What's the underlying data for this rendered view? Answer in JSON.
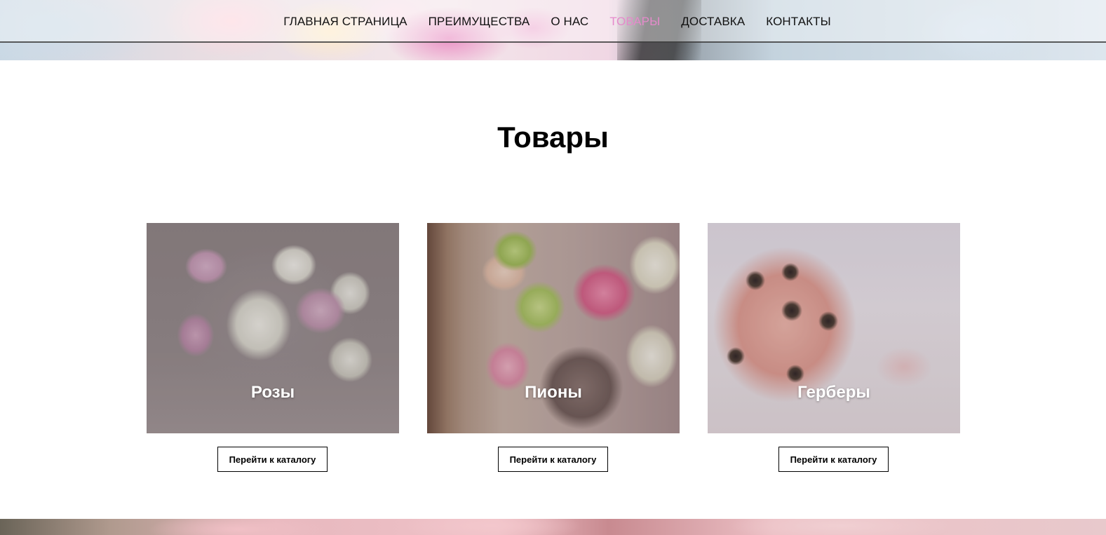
{
  "nav": {
    "items": [
      {
        "label": "ГЛАВНАЯ СТРАНИЦА"
      },
      {
        "label": "ПРЕИМУЩЕСТВА"
      },
      {
        "label": "О НАС"
      },
      {
        "label": "ТОВАРЫ"
      },
      {
        "label": "ДОСТАВКА"
      },
      {
        "label": "КОНТАКТЫ"
      }
    ],
    "active_index": 3,
    "active_color": "#e58acb"
  },
  "section": {
    "title": "Товары"
  },
  "products": [
    {
      "title": "Розы",
      "button_label": "Перейти к каталогу"
    },
    {
      "title": "Пионы",
      "button_label": "Перейти к каталогу"
    },
    {
      "title": "Герберы",
      "button_label": "Перейти к каталогу"
    }
  ]
}
